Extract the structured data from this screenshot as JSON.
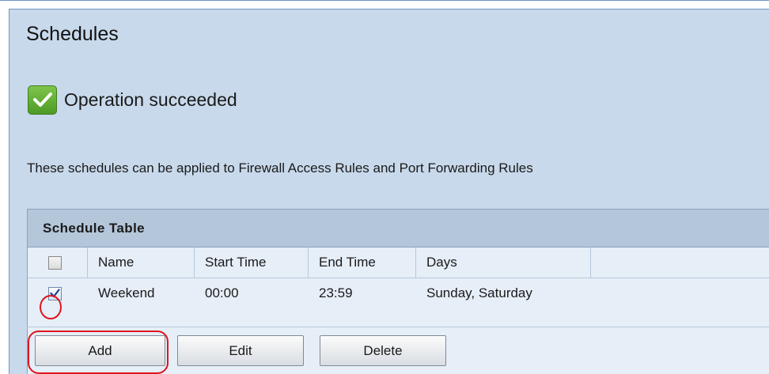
{
  "page": {
    "title": "Schedules"
  },
  "status": {
    "icon": "check-icon",
    "message": "Operation succeeded"
  },
  "description": "These schedules can be applied to Firewall Access Rules and Port Forwarding Rules",
  "table": {
    "caption": "Schedule Table",
    "columns": [
      "Name",
      "Start Time",
      "End Time",
      "Days"
    ],
    "rows": [
      {
        "checked": true,
        "name": "Weekend",
        "start": "00:00",
        "end": "23:59",
        "days": "Sunday, Saturday"
      }
    ]
  },
  "buttons": {
    "add": "Add",
    "edit": "Edit",
    "delete": "Delete"
  },
  "colors": {
    "highlight": "#e0141e",
    "panel": "#c8d9eb",
    "success": "#5aa832"
  }
}
